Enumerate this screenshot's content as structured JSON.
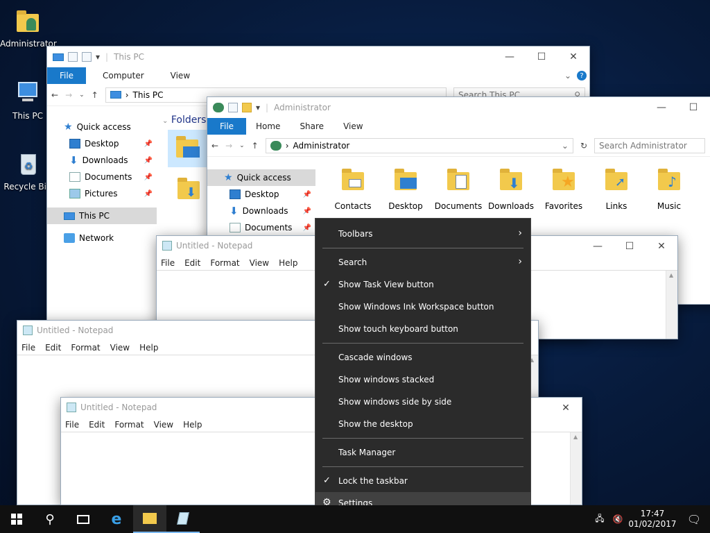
{
  "desktop": {
    "icons": [
      {
        "label": "Administrator"
      },
      {
        "label": "This PC"
      },
      {
        "label": "Recycle Bin"
      }
    ]
  },
  "explorer_thispc": {
    "title": "This PC",
    "tabs": {
      "file": "File",
      "computer": "Computer",
      "view": "View"
    },
    "address": "This PC",
    "search_placeholder": "Search This PC",
    "section": "Folders",
    "nav": {
      "quick_access": "Quick access",
      "desktop": "Desktop",
      "downloads": "Downloads",
      "documents": "Documents",
      "pictures": "Pictures",
      "this_pc": "This PC",
      "network": "Network"
    }
  },
  "explorer_admin": {
    "title": "Administrator",
    "tabs": {
      "file": "File",
      "home": "Home",
      "share": "Share",
      "view": "View"
    },
    "address": "Administrator",
    "search_placeholder": "Search Administrator",
    "nav": {
      "quick_access": "Quick access",
      "desktop": "Desktop",
      "downloads": "Downloads",
      "documents": "Documents"
    },
    "folders": [
      {
        "label": "Contacts"
      },
      {
        "label": "Desktop"
      },
      {
        "label": "Documents"
      },
      {
        "label": "Downloads"
      },
      {
        "label": "Favorites"
      },
      {
        "label": "Links"
      },
      {
        "label": "Music"
      }
    ]
  },
  "notepad": {
    "title": "Untitled - Notepad",
    "menu": {
      "file": "File",
      "edit": "Edit",
      "format": "Format",
      "view": "View",
      "help": "Help"
    }
  },
  "context_menu": {
    "toolbars": "Toolbars",
    "search": "Search",
    "show_task_view": "Show Task View button",
    "show_ink": "Show Windows Ink Workspace button",
    "show_touch_kb": "Show touch keyboard button",
    "cascade": "Cascade windows",
    "stacked": "Show windows stacked",
    "side_by_side": "Show windows side by side",
    "show_desktop": "Show the desktop",
    "task_manager": "Task Manager",
    "lock_taskbar": "Lock the taskbar",
    "settings": "Settings"
  },
  "taskbar": {
    "time": "17:47",
    "date": "01/02/2017"
  },
  "colors": {
    "accent": "#1979ca",
    "menu_bg": "#2b2b2b",
    "taskbar_bg": "#101010"
  }
}
